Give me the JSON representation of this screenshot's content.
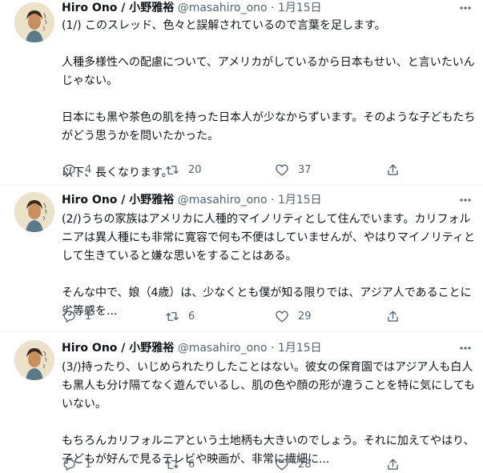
{
  "tweets": [
    {
      "name": "Hiro Ono / 小野雅裕",
      "handle": "@masahiro_ono",
      "separator": "·",
      "date": "1月15日",
      "paragraphs": [
        "(1/) このスレッド、色々と誤解されているので言葉を足します。",
        "人種多様性への配慮について、アメリカがしているから日本もせい、と言いたいんじゃない。",
        "日本にも黒や茶色の肌を持った日本人が少なからずいます。そのような子どもたちがどう思うかを問いたかった。",
        "以下、長くなります。"
      ],
      "replies": "4",
      "retweets": "20",
      "likes": "37"
    },
    {
      "name": "Hiro Ono / 小野雅裕",
      "handle": "@masahiro_ono",
      "separator": "·",
      "date": "1月15日",
      "paragraphs": [
        "(2/)うちの家族はアメリカに人種的マイノリティとして住んでいます。カリフォルニアは異人種にも非常に寛容で何も不便はしていませんが、やはりマイノリティとして生きていると嫌な思いをすることはある。",
        "そんな中で、娘（4歳）は、少なくとも僕が知る限りでは、アジア人であることに劣等感を..."
      ],
      "replies": "1",
      "retweets": "6",
      "likes": "29"
    },
    {
      "name": "Hiro Ono / 小野雅裕",
      "handle": "@masahiro_ono",
      "separator": "·",
      "date": "1月15日",
      "paragraphs": [
        "(3/)持ったり、いじめられたりしたことはない。彼女の保育園ではアジア人も白人も黒人も分け隔てなく遊んでいるし、肌の色や顔の形が違うことを特に気にしてもいない。",
        "もちろんカリフォルニアという土地柄も大きいのでしょう。それに加えてやはり、子どもが好んで見るテレビや映画が、非常に繊細に..."
      ],
      "replies": "1",
      "retweets": "6",
      "likes": "28"
    }
  ],
  "icons": {
    "avatar": "avatar-sketch-icon",
    "more": "more-dots-icon",
    "reply": "reply-bubble-icon",
    "retweet": "retweet-icon",
    "like": "heart-icon",
    "share": "share-upload-icon"
  },
  "colors": {
    "text": "#0f1419",
    "muted": "#536471",
    "divider": "#eff3f4"
  }
}
